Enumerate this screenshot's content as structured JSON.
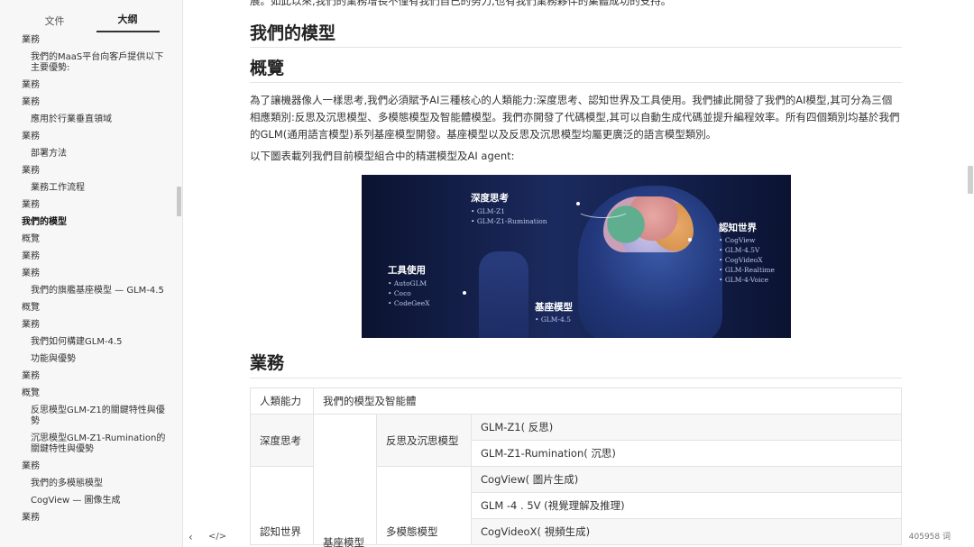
{
  "sidebar": {
    "tabs": [
      {
        "label": "文件",
        "active": false
      },
      {
        "label": "大纲",
        "active": true
      }
    ],
    "outline": [
      {
        "label": "業務",
        "level": 1,
        "bold": false
      },
      {
        "label": "我們的MaaS平台向客戶提供以下主要優勢:",
        "level": 2,
        "bold": false
      },
      {
        "label": "業務",
        "level": 1,
        "bold": false
      },
      {
        "label": "業務",
        "level": 1,
        "bold": false
      },
      {
        "label": "應用於行業垂直領域",
        "level": 2,
        "bold": false
      },
      {
        "label": "業務",
        "level": 1,
        "bold": false
      },
      {
        "label": "部署方法",
        "level": 2,
        "bold": false
      },
      {
        "label": "業務",
        "level": 1,
        "bold": false
      },
      {
        "label": "業務工作流程",
        "level": 2,
        "bold": false
      },
      {
        "label": "業務",
        "level": 1,
        "bold": false
      },
      {
        "label": "我們的模型",
        "level": 1,
        "bold": true
      },
      {
        "label": "概覽",
        "level": 1,
        "bold": false
      },
      {
        "label": "業務",
        "level": 1,
        "bold": false
      },
      {
        "label": "業務",
        "level": 1,
        "bold": false
      },
      {
        "label": "我們的旗艦基座模型 — GLM-4.5",
        "level": 2,
        "bold": false
      },
      {
        "label": "概覽",
        "level": 1,
        "bold": false
      },
      {
        "label": "業務",
        "level": 1,
        "bold": false
      },
      {
        "label": "我們如何構建GLM-4.5",
        "level": 2,
        "bold": false
      },
      {
        "label": "功能與優勢",
        "level": 2,
        "bold": false
      },
      {
        "label": "業務",
        "level": 1,
        "bold": false
      },
      {
        "label": "概覽",
        "level": 1,
        "bold": false
      },
      {
        "label": "反思模型GLM-Z1的關鍵特性與優勢",
        "level": 2,
        "bold": false
      },
      {
        "label": "沉思模型GLM-Z1-Rumination的關鍵特性與優勢",
        "level": 2,
        "bold": false
      },
      {
        "label": "業務",
        "level": 1,
        "bold": false
      },
      {
        "label": "我們的多模態模型",
        "level": 2,
        "bold": false
      },
      {
        "label": "CogView — 圖像生成",
        "level": 2,
        "bold": false
      },
      {
        "label": "業務",
        "level": 1,
        "bold": false
      }
    ],
    "footer_icons": [
      "chevron-left-icon",
      "code-icon"
    ]
  },
  "document": {
    "top_line": "展。如此以來,我們的業務增長不僅有我們自己的努力,也有我們業務夥伴的集體成功的支持。",
    "heading_models": "我們的模型",
    "heading_overview": "概覽",
    "para1": "為了讓機器像人一樣思考,我們必須賦予AI三種核心的人類能力:深度思考、認知世界及工具使用。我們據此開發了我們的AI模型,其可分為三個相應類別:反思及沉思模型、多模態模型及智能體模型。我們亦開發了代碼模型,其可以自動生成代碼並提升編程效率。所有四個類別均基於我們的GLM(通用語言模型)系列基座模型開發。基座模型以及反思及沉思模型均屬更廣泛的語言模型類別。",
    "para2": "以下圖表載列我們目前模型組合中的精選模型及AI agent:",
    "figure": {
      "groups": [
        {
          "title": "深度思考",
          "items": [
            "GLM-Z1",
            "GLM-Z1-Rumination"
          ]
        },
        {
          "title": "認知世界",
          "items": [
            "CogView",
            "GLM-4.5V",
            "CogVideoX",
            "GLM-Realtime",
            "GLM-4-Voice"
          ]
        },
        {
          "title": "工具使用",
          "items": [
            "AutoGLM",
            "Coco",
            "CodeGeeX"
          ]
        },
        {
          "title": "基座模型",
          "items": [
            "GLM-4.5"
          ]
        }
      ]
    },
    "heading_business": "業務",
    "table": {
      "header": [
        "人類能力",
        "我們的模型及智能體"
      ],
      "rows": [
        {
          "capability": "深度思考",
          "category": "反思及沉思模型",
          "models": [
            "GLM-Z1( 反思)",
            "GLM-Z1-Rumination( 沉思)"
          ]
        },
        {
          "capability": "認知世界",
          "category": "多模態模型",
          "models": [
            "CogView( 圖片生成)",
            "GLM -4 . 5V (視覺理解及推理)",
            "CogVideoX( 視頻生成)"
          ]
        }
      ],
      "group_label": "基座模型"
    }
  },
  "status": {
    "word_count": "405958 词"
  }
}
